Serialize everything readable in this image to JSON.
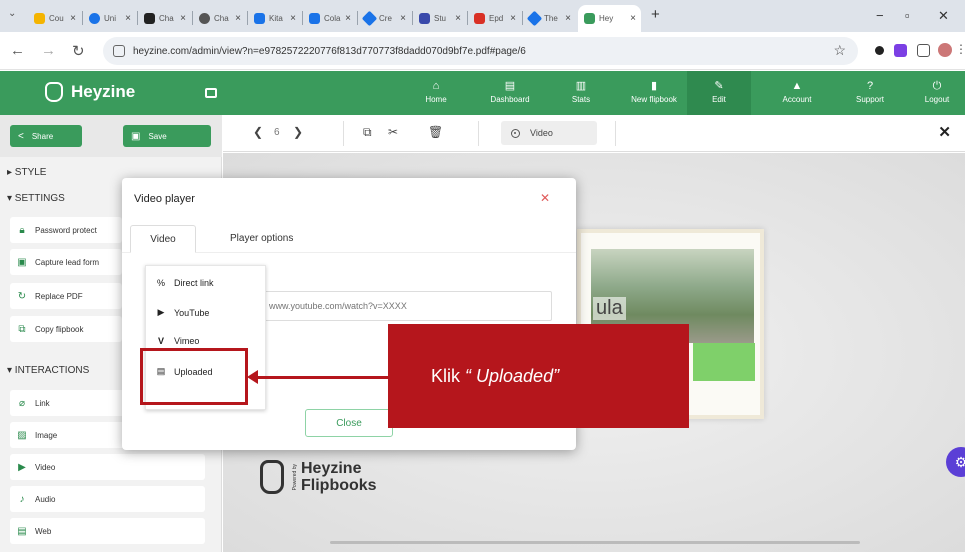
{
  "browser": {
    "tabs": [
      {
        "label": "Cou",
        "color": "#f4b400"
      },
      {
        "label": "Uni",
        "color": "#1a73e8"
      },
      {
        "label": "Cha",
        "color": "#222222"
      },
      {
        "label": "Cha",
        "color": "#555555"
      },
      {
        "label": "Kita",
        "color": "#1a73e8"
      },
      {
        "label": "Cola",
        "color": "#1a73e8"
      },
      {
        "label": "Cre",
        "color": "#1a73e8"
      },
      {
        "label": "Stu",
        "color": "#3949ab"
      },
      {
        "label": "Epd",
        "color": "#d93025"
      },
      {
        "label": "The",
        "color": "#1a73e8"
      }
    ],
    "active_tab": {
      "label": "Hey",
      "color": "#3a9b5c"
    },
    "url": "heyzine.com/admin/view?n=e9782572220776f813d770773f8dadd070d9bf7e.pdf#page/6"
  },
  "header": {
    "brand": "Heyzine",
    "nav": [
      {
        "label": "Home",
        "glyph": "⌂"
      },
      {
        "label": "Dashboard",
        "glyph": "▤"
      },
      {
        "label": "Stats",
        "glyph": "▥"
      },
      {
        "label": "New flipbook",
        "glyph": "▮"
      },
      {
        "label": "Edit",
        "glyph": "✎",
        "active": true
      },
      {
        "label": "Account",
        "glyph": "▲"
      },
      {
        "label": "Support",
        "glyph": "?"
      },
      {
        "label": "Logout",
        "glyph": "⏻"
      }
    ]
  },
  "sidebar": {
    "share_label": "Share",
    "save_label": "Save",
    "style_label": "▸ STYLE",
    "settings_label": "▾ SETTINGS",
    "settings_items": [
      {
        "label": "Password protect",
        "icon": "lock-icon"
      },
      {
        "label": "Capture lead form",
        "icon": "form-icon"
      },
      {
        "label": "Replace PDF",
        "icon": "refresh-icon"
      },
      {
        "label": "Copy flipbook",
        "icon": "copy-icon"
      }
    ],
    "interactions_label": "▾ INTERACTIONS",
    "interaction_items": [
      {
        "label": "Link",
        "icon": "link-icon"
      },
      {
        "label": "Image",
        "icon": "image-icon"
      },
      {
        "label": "Video",
        "icon": "play-icon"
      },
      {
        "label": "Audio",
        "icon": "audio-icon"
      },
      {
        "label": "Web",
        "icon": "web-icon"
      }
    ]
  },
  "editor": {
    "page_number": "6",
    "tool_label": "Video"
  },
  "canvas": {
    "page_text": "ula",
    "logo_line1": "Heyzine",
    "logo_line2": "Flipbooks",
    "logo_small": "Powered by"
  },
  "dialog": {
    "title": "Video player",
    "tabs": [
      "Video",
      "Player options"
    ],
    "url_placeholder": "www.youtube.com/watch?v=XXXX",
    "close_button": "Close"
  },
  "dropdown": {
    "items": [
      {
        "label": "Direct link",
        "icon": "link-icon"
      },
      {
        "label": "YouTube",
        "icon": "youtube-icon"
      },
      {
        "label": "Vimeo",
        "icon": "vimeo-icon"
      },
      {
        "label": "Uploaded",
        "icon": "file-icon"
      }
    ]
  },
  "annotation": {
    "prefix": "Klik",
    "text": "“ Uploaded”",
    "color": "#b5161c"
  }
}
